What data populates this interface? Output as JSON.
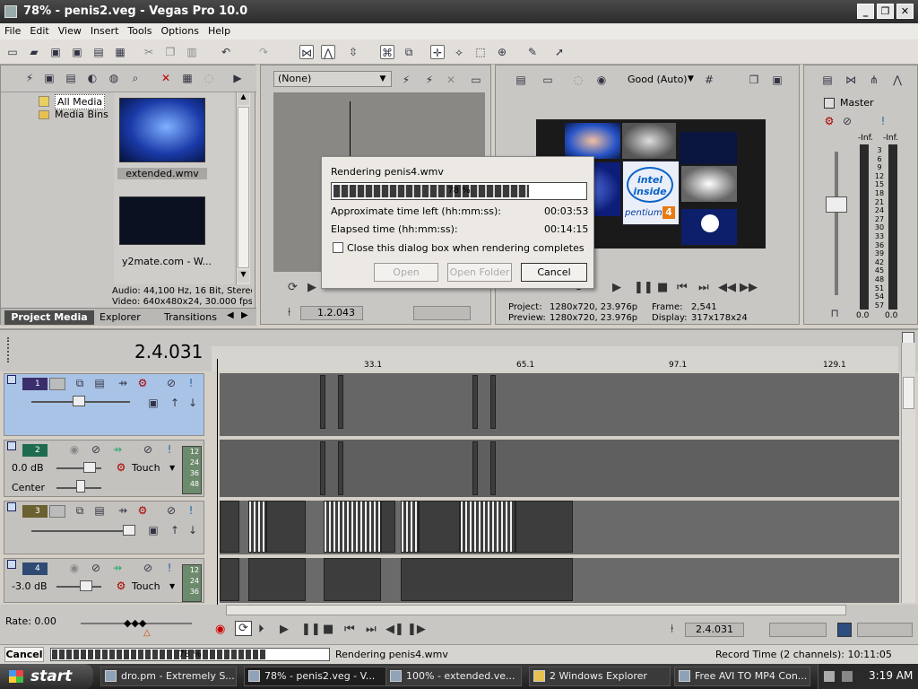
{
  "window": {
    "title": "78% - penis2.veg - Vegas Pro 10.0",
    "min": "_",
    "max": "❐",
    "close": "✕"
  },
  "menu": [
    "File",
    "Edit",
    "View",
    "Insert",
    "Tools",
    "Options",
    "Help"
  ],
  "explorer": {
    "tree": {
      "all_media": "All Media",
      "media_bins": "Media Bins"
    },
    "thumbs": [
      {
        "label": "extended.wmv"
      },
      {
        "label": "y2mate.com - W..."
      }
    ],
    "info_line1": "Audio: 44,100 Hz, 16 Bit, Stereo",
    "info_line2": "Video: 640x480x24, 30.000 fps",
    "tabs": [
      "Project Media",
      "Explorer",
      "Transitions"
    ]
  },
  "trimmer": {
    "dropdown": "(None)",
    "time": "1.2.043"
  },
  "preview": {
    "quality": "Good (Auto)",
    "project_label": "Project:",
    "project_value": "1280x720, 23.976p",
    "preview_label": "Preview:",
    "preview_value": "1280x720, 23.976p",
    "frame_label": "Frame:",
    "frame_value": "2,541",
    "display_label": "Display:",
    "display_value": "317x178x24",
    "logo_line1": "intel",
    "logo_line2": "inside",
    "logo_line3": "pentium",
    "logo_num": "4"
  },
  "mixer": {
    "title": "Master",
    "inf_left": "-Inf.",
    "inf_right": "-Inf.",
    "scale": [
      "3",
      "6",
      "9",
      "12",
      "15",
      "18",
      "21",
      "24",
      "27",
      "30",
      "33",
      "36",
      "39",
      "42",
      "45",
      "48",
      "51",
      "54",
      "57"
    ],
    "bottom_left": "0.0",
    "bottom_right": "0.0"
  },
  "timeline": {
    "cursor_time": "2.4.031",
    "ruler": [
      "33.1",
      "65.1",
      "97.1",
      "129.1"
    ],
    "rate": "Rate: 0.00",
    "bottom_time": "2.4.031",
    "tracks": [
      {
        "num": "1"
      },
      {
        "num": "2",
        "vol": "0.0 dB",
        "pan": "Center",
        "mode": "Touch",
        "meter": [
          "12",
          "24",
          "36",
          "48"
        ]
      },
      {
        "num": "3"
      },
      {
        "num": "4",
        "vol": "-3.0 dB",
        "mode": "Touch",
        "meter": [
          "12",
          "24",
          "36"
        ]
      }
    ]
  },
  "dialog": {
    "title": "Rendering penis4.wmv",
    "progress_text": "78 %",
    "progress": 0.78,
    "time_left_label": "Approximate time left (hh:mm:ss):",
    "time_left": "00:03:53",
    "elapsed_label": "Elapsed time (hh:mm:ss):",
    "elapsed": "00:14:15",
    "checkbox": "Close this dialog box when rendering completes",
    "open": "Open",
    "open_folder": "Open Folder",
    "cancel": "Cancel"
  },
  "status": {
    "cancel": "Cancel",
    "progress_text": "78 %",
    "progress": 0.78,
    "message": "Rendering penis4.wmv",
    "record_time": "Record Time (2 channels): 10:11:05"
  },
  "taskbar": {
    "start": "start",
    "tasks": [
      "dro.pm - Extremely S...",
      "78% - penis2.veg - V...",
      "100% - extended.ve...",
      "2 Windows Explorer",
      "Free AVI TO MP4 Con..."
    ],
    "clock": "3:19 AM"
  },
  "colors": {
    "track1": "#3a2f6b",
    "track2": "#1f6b4f",
    "track3": "#6b6030",
    "track4": "#2f4a73"
  }
}
